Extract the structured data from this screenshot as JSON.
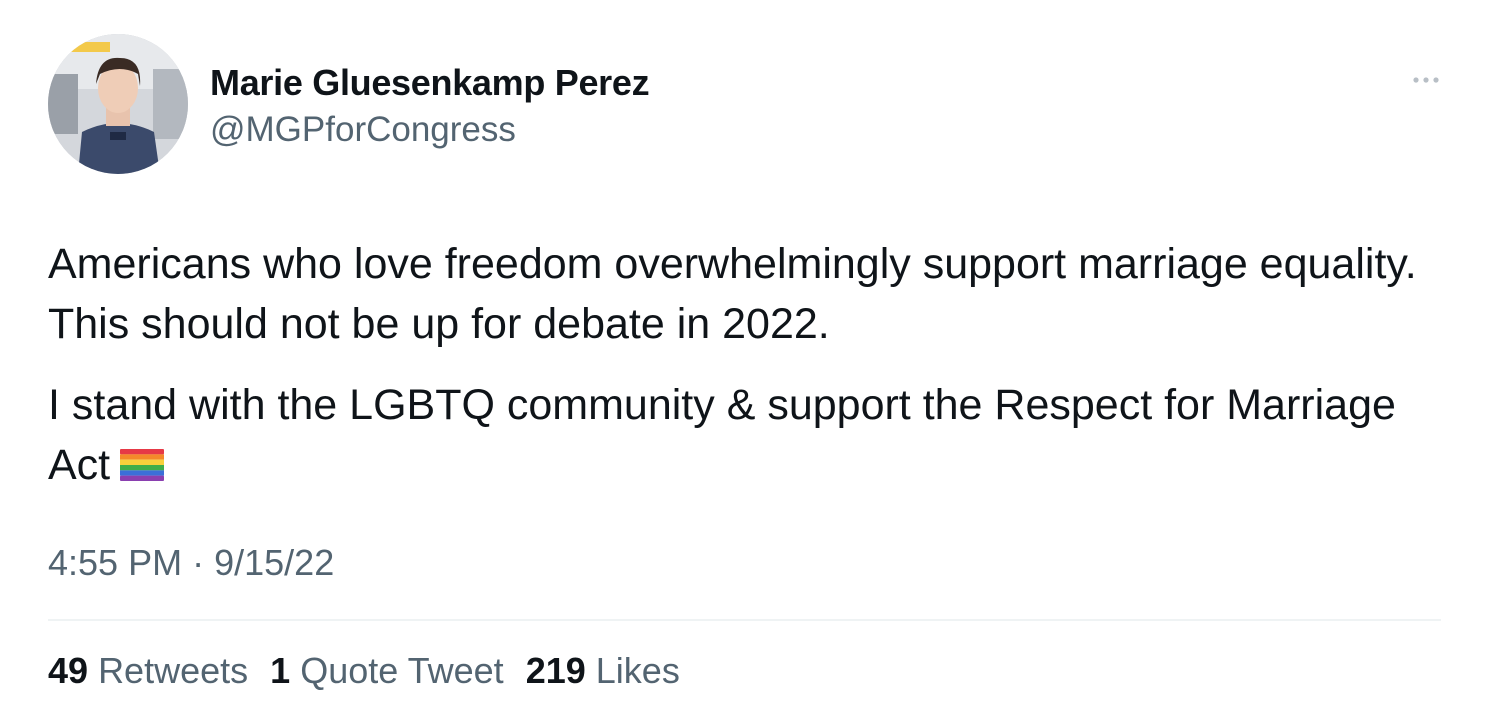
{
  "author": {
    "display_name": "Marie Gluesenkamp Perez",
    "handle": "@MGPforCongress"
  },
  "tweet": {
    "paragraph_1": "Americans who love freedom overwhelmingly support marriage equality. This should not be up for debate in 2022.",
    "paragraph_2": "I stand with the LGBTQ community & support the Respect for Marriage Act",
    "emoji": "rainbow-flag-icon",
    "time": "4:55 PM",
    "separator": "·",
    "date": "9/15/22"
  },
  "stats": {
    "retweets_count": "49",
    "retweets_label": "Retweets",
    "quotes_count": "1",
    "quotes_label": "Quote Tweet",
    "likes_count": "219",
    "likes_label": "Likes"
  },
  "colors": {
    "text": "#0f1419",
    "secondary": "#536471",
    "divider": "#eff3f4"
  }
}
